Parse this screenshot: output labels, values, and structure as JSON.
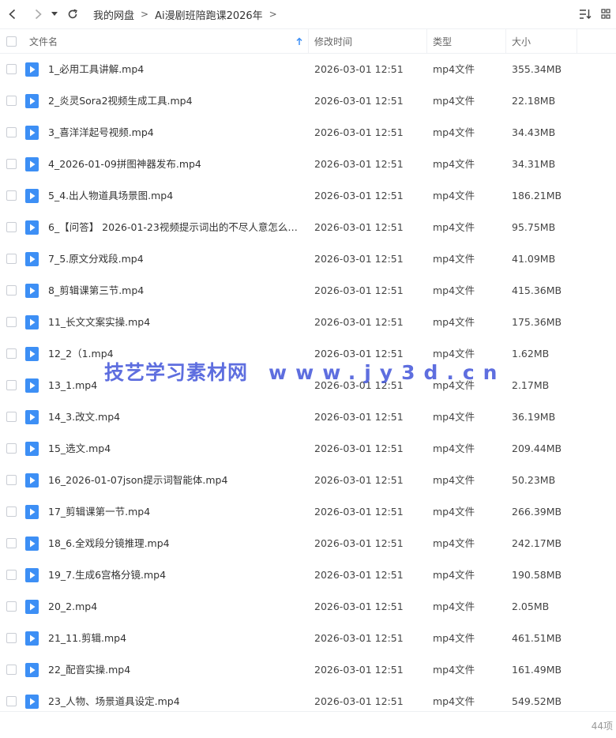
{
  "breadcrumb": [
    "我的网盘",
    "Ai漫剧班陪跑课2026年"
  ],
  "columns": {
    "name": "文件名",
    "modified": "修改时间",
    "type": "类型",
    "size": "大小"
  },
  "files": [
    {
      "name": "1_必用工具讲解.mp4",
      "modified": "2026-03-01 12:51",
      "type": "mp4文件",
      "size": "355.34MB"
    },
    {
      "name": "2_炎灵Sora2视频生成工具.mp4",
      "modified": "2026-03-01 12:51",
      "type": "mp4文件",
      "size": "22.18MB"
    },
    {
      "name": "3_喜洋洋起号视频.mp4",
      "modified": "2026-03-01 12:51",
      "type": "mp4文件",
      "size": "34.43MB"
    },
    {
      "name": "4_2026-01-09拼图神器发布.mp4",
      "modified": "2026-03-01 12:51",
      "type": "mp4文件",
      "size": "34.31MB"
    },
    {
      "name": "5_4.出人物道具场景图.mp4",
      "modified": "2026-03-01 12:51",
      "type": "mp4文件",
      "size": "186.21MB"
    },
    {
      "name": "6_【问答】 2026-01-23视频提示词出的不尽人意怎么办？...",
      "modified": "2026-03-01 12:51",
      "type": "mp4文件",
      "size": "95.75MB"
    },
    {
      "name": "7_5.原文分戏段.mp4",
      "modified": "2026-03-01 12:51",
      "type": "mp4文件",
      "size": "41.09MB"
    },
    {
      "name": "8_剪辑课第三节.mp4",
      "modified": "2026-03-01 12:51",
      "type": "mp4文件",
      "size": "415.36MB"
    },
    {
      "name": "11_长文文案实操.mp4",
      "modified": "2026-03-01 12:51",
      "type": "mp4文件",
      "size": "175.36MB"
    },
    {
      "name": "12_2（1.mp4",
      "modified": "2026-03-01 12:51",
      "type": "mp4文件",
      "size": "1.62MB"
    },
    {
      "name": "13_1.mp4",
      "modified": "2026-03-01 12:51",
      "type": "mp4文件",
      "size": "2.17MB"
    },
    {
      "name": "14_3.改文.mp4",
      "modified": "2026-03-01 12:51",
      "type": "mp4文件",
      "size": "36.19MB"
    },
    {
      "name": "15_选文.mp4",
      "modified": "2026-03-01 12:51",
      "type": "mp4文件",
      "size": "209.44MB"
    },
    {
      "name": "16_2026-01-07json提示词智能体.mp4",
      "modified": "2026-03-01 12:51",
      "type": "mp4文件",
      "size": "50.23MB"
    },
    {
      "name": "17_剪辑课第一节.mp4",
      "modified": "2026-03-01 12:51",
      "type": "mp4文件",
      "size": "266.39MB"
    },
    {
      "name": "18_6.全戏段分镜推理.mp4",
      "modified": "2026-03-01 12:51",
      "type": "mp4文件",
      "size": "242.17MB"
    },
    {
      "name": "19_7.生成6宫格分镜.mp4",
      "modified": "2026-03-01 12:51",
      "type": "mp4文件",
      "size": "190.58MB"
    },
    {
      "name": "20_2.mp4",
      "modified": "2026-03-01 12:51",
      "type": "mp4文件",
      "size": "2.05MB"
    },
    {
      "name": "21_11.剪辑.mp4",
      "modified": "2026-03-01 12:51",
      "type": "mp4文件",
      "size": "461.51MB"
    },
    {
      "name": "22_配音实操.mp4",
      "modified": "2026-03-01 12:51",
      "type": "mp4文件",
      "size": "161.49MB"
    },
    {
      "name": "23_人物、场景道具设定.mp4",
      "modified": "2026-03-01 12:51",
      "type": "mp4文件",
      "size": "549.52MB"
    }
  ],
  "footer": {
    "count": "44项"
  },
  "watermark": {
    "site_name": "技艺学习素材网",
    "url": "www.jy3d.cn"
  },
  "colors": {
    "file_icon": "#3d8ff5",
    "sort_arrow": "#3d8ff5",
    "watermark": "#3b4fd8"
  }
}
